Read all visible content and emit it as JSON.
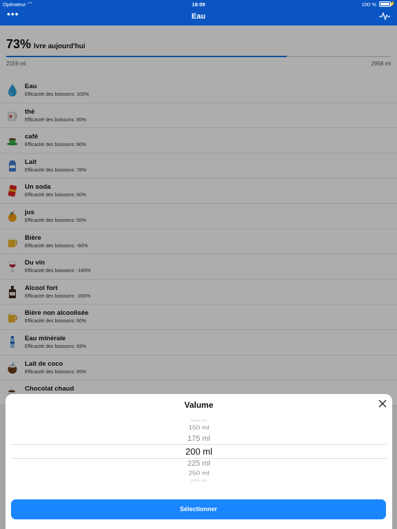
{
  "status_bar": {
    "carrier": "Opérateur",
    "time": "18:09",
    "battery": "100 %"
  },
  "nav": {
    "title": "Eau",
    "more_icon": "ellipsis-icon",
    "activity_icon": "activity-icon"
  },
  "progress": {
    "percent_text": "73%",
    "label": "lvre aujourd'hui",
    "fraction": 0.73,
    "consumed": "2159 ml",
    "goal": "2958 ml"
  },
  "drinks": [
    {
      "name": "Eau",
      "efficiency": "Efficacité des boissons: 100%",
      "icon": "water-drop-icon"
    },
    {
      "name": "thé",
      "efficiency": "Efficacité des boissons: 85%",
      "icon": "tea-mug-icon"
    },
    {
      "name": "café",
      "efficiency": "Efficacité des boissons: 80%",
      "icon": "coffee-cup-icon"
    },
    {
      "name": "Lait",
      "efficiency": "Efficacité des boissons: 78%",
      "icon": "milk-carton-icon"
    },
    {
      "name": "Un soda",
      "efficiency": "Efficacité des boissons: 60%",
      "icon": "soda-can-icon"
    },
    {
      "name": "jus",
      "efficiency": "Efficacité des boissons: 55%",
      "icon": "juice-icon"
    },
    {
      "name": "Bière",
      "efficiency": "Efficacité des boissons: -60%",
      "icon": "beer-mug-icon"
    },
    {
      "name": "Du vin",
      "efficiency": "Efficacité des boissons: -160%",
      "icon": "wine-glass-icon"
    },
    {
      "name": "Alcool fort",
      "efficiency": "Efficacité des boissons: -350%",
      "icon": "liquor-bottle-icon"
    },
    {
      "name": "Bière non alcoolisée",
      "efficiency": "Efficacité des boissons: 60%",
      "icon": "beer-mug-icon"
    },
    {
      "name": "Eau minérale",
      "efficiency": "Efficacité des boissons: 93%",
      "icon": "water-bottle-icon"
    },
    {
      "name": "Lait de coco",
      "efficiency": "Efficacité des boissons: 85%",
      "icon": "coconut-icon"
    },
    {
      "name": "Chocolat chaud",
      "efficiency": "",
      "icon": "hot-chocolate-icon"
    }
  ],
  "modal": {
    "title": "Valume",
    "close_icon": "close-icon",
    "options": [
      "125 ml",
      "150 ml",
      "175 ml",
      "200 ml",
      "225 ml",
      "250 ml",
      "275 ml"
    ],
    "selected": "200 ml",
    "select_label": "Sélectionner"
  },
  "colors": {
    "nav_blue": "#0a55c2",
    "button_blue": "#1a86ff",
    "progress_blue": "#1a73e8"
  }
}
